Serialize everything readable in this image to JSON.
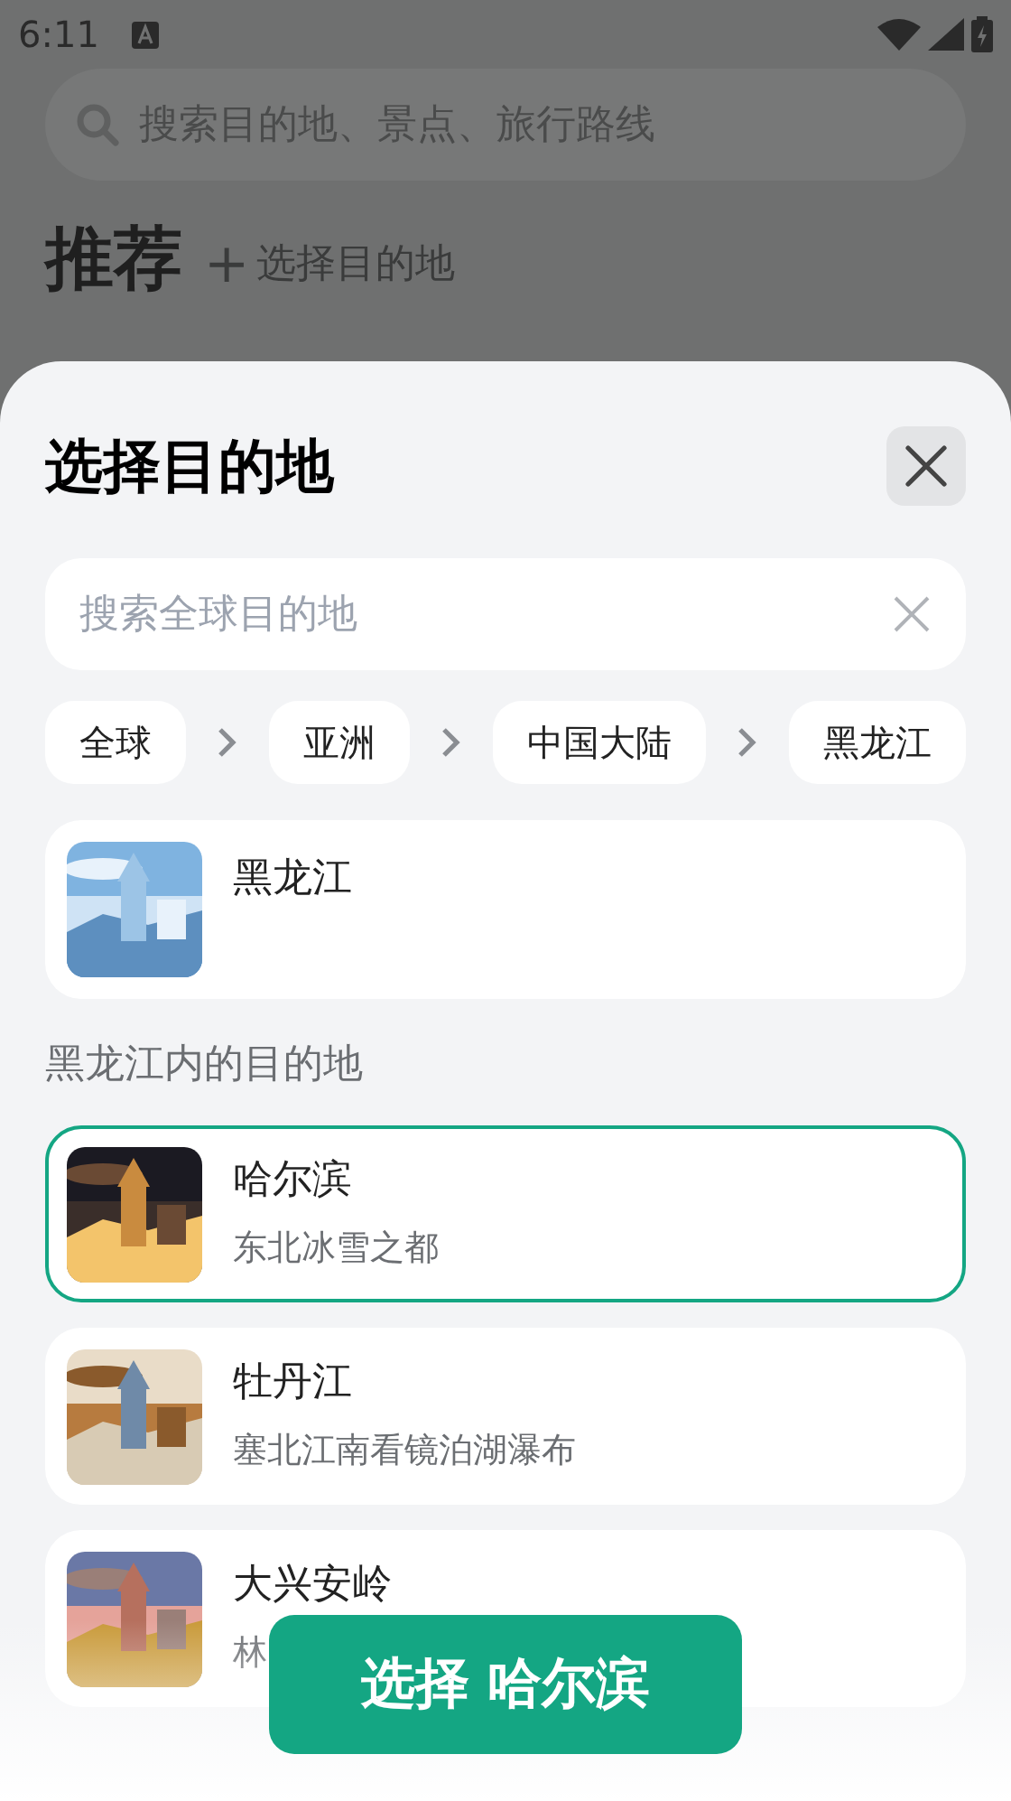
{
  "status_bar": {
    "time": "6:11"
  },
  "background": {
    "search": {
      "placeholder": "搜索目的地、景点、旅行路线"
    },
    "heading": "推荐",
    "add_link": {
      "icon": "+",
      "label": "选择目的地"
    }
  },
  "sheet": {
    "title": "选择目的地",
    "search": {
      "placeholder": "搜索全球目的地"
    },
    "breadcrumb": [
      {
        "label": "全球"
      },
      {
        "label": "亚洲"
      },
      {
        "label": "中国大陆"
      },
      {
        "label": "黑龙江"
      }
    ],
    "current": {
      "name": "黑龙江"
    },
    "section_label": "黑龙江内的目的地",
    "destinations": [
      {
        "name": "哈尔滨",
        "subtitle": "东北冰雪之都",
        "selected": true
      },
      {
        "name": "牡丹江",
        "subtitle": "塞北江南看镜泊湖瀑布",
        "selected": false
      },
      {
        "name": "大兴安岭",
        "subtitle": "林",
        "selected": false
      }
    ],
    "confirm_button": "选择 哈尔滨"
  }
}
